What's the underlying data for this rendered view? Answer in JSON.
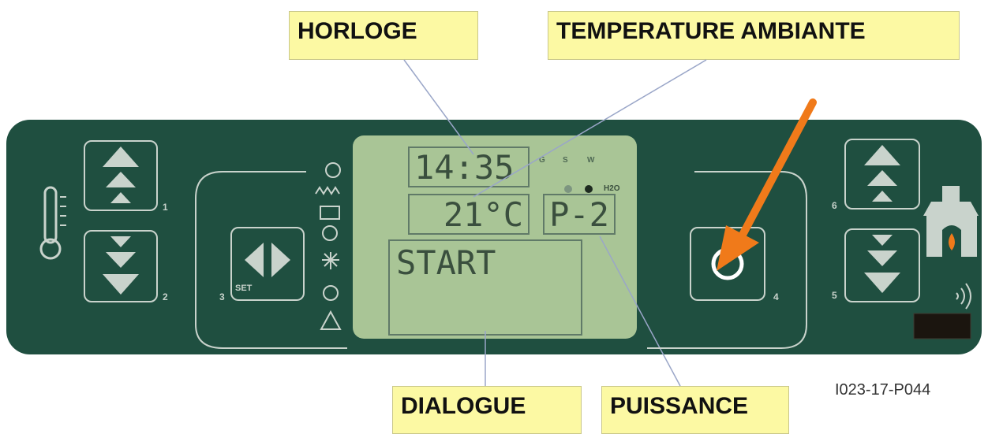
{
  "callouts": {
    "horloge": "HORLOGE",
    "temperature": "TEMPERATURE AMBIANTE",
    "dialogue": "DIALOGUE",
    "puissance": "PUISSANCE"
  },
  "lcd": {
    "clock": "14:35",
    "temperature": "21°C",
    "power": "P-2",
    "message": "START",
    "days": [
      "G",
      "S",
      "W"
    ],
    "h2o_label": "H2O"
  },
  "buttons": {
    "b1": "1",
    "b2": "2",
    "b3": "3",
    "b3_set": "SET",
    "b4": "4",
    "b5": "5",
    "b6": "6"
  },
  "figure_code": "I023-17-P044",
  "colors": {
    "panel": "#1f4f40",
    "lcd": "#a9c596",
    "callout": "#fcf9a3",
    "arrow": "#f07a1a"
  }
}
